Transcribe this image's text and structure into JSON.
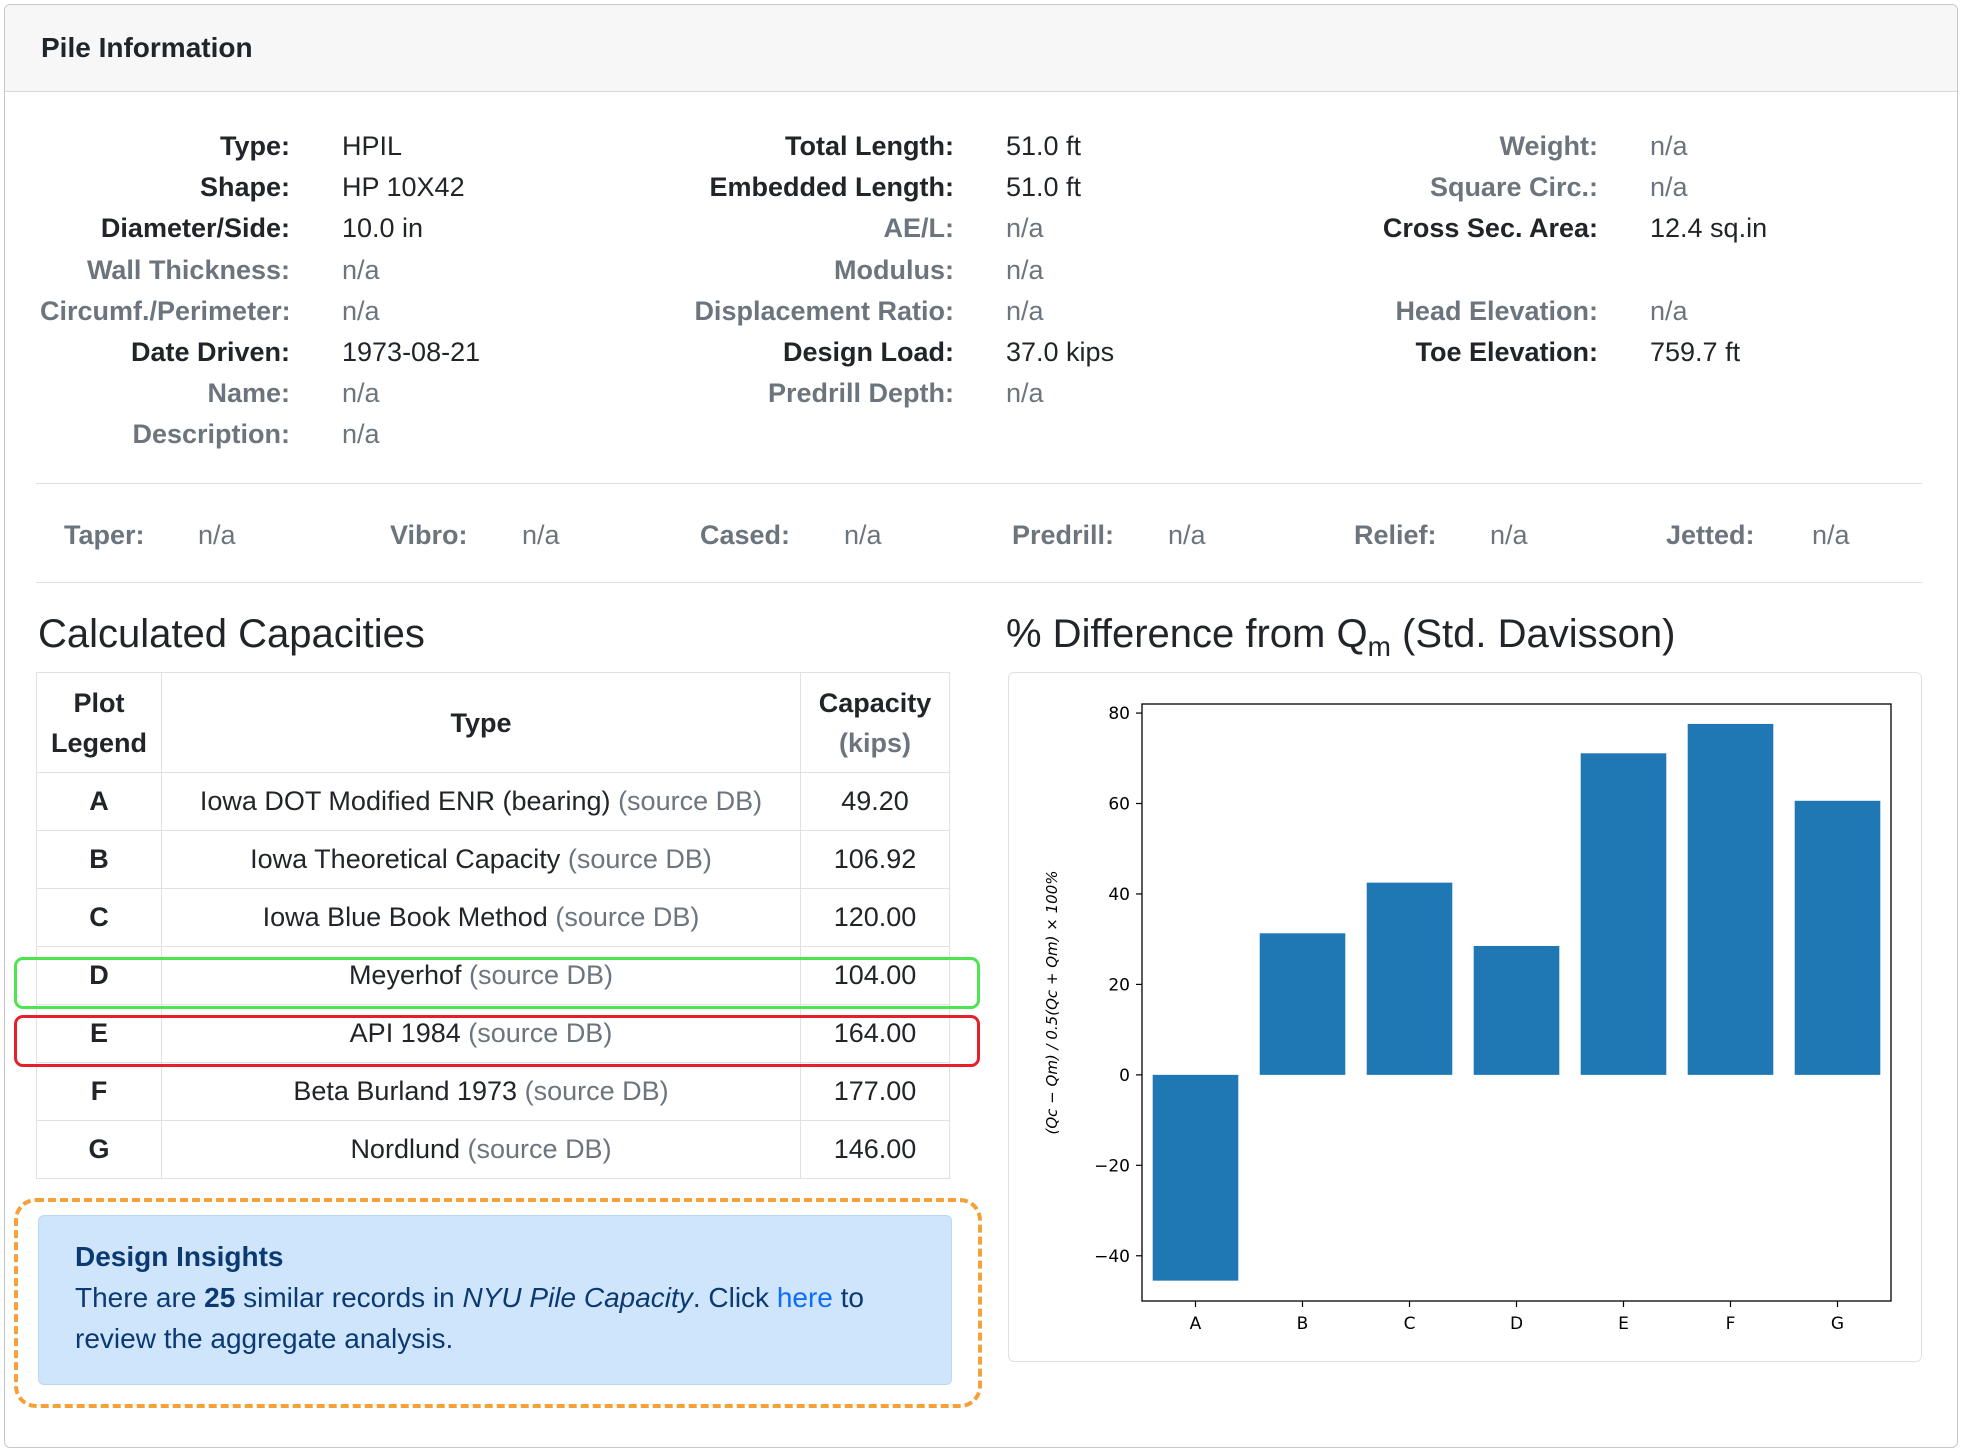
{
  "header": {
    "title": "Pile Information"
  },
  "info": {
    "col1": [
      {
        "label": "Type:",
        "value": "HPIL",
        "strong": true
      },
      {
        "label": "Shape:",
        "value": "HP 10X42",
        "strong": true
      },
      {
        "label": "Diameter/Side:",
        "value": "10.0 in",
        "strong": true
      },
      {
        "label": "Wall Thickness:",
        "value": "n/a",
        "strong": false
      },
      {
        "label": "Circumf./Perimeter:",
        "value": "n/a",
        "strong": false
      },
      {
        "label": "Date Driven:",
        "value": "1973-08-21",
        "strong": true
      },
      {
        "label": "Name:",
        "value": "n/a",
        "strong": false
      },
      {
        "label": "Description:",
        "value": "n/a",
        "strong": false
      }
    ],
    "col2": [
      {
        "label": "Total Length:",
        "value": "51.0 ft",
        "strong": true
      },
      {
        "label": "Embedded Length:",
        "value": "51.0 ft",
        "strong": true
      },
      {
        "label": "AE/L:",
        "value": "n/a",
        "strong": false
      },
      {
        "label": "Modulus:",
        "value": "n/a",
        "strong": false
      },
      {
        "label": "Displacement Ratio:",
        "value": "n/a",
        "strong": false
      },
      {
        "label": "Design Load:",
        "value": "37.0 kips",
        "strong": true
      },
      {
        "label": "Predrill Depth:",
        "value": "n/a",
        "strong": false
      }
    ],
    "col3": [
      {
        "label": "Weight:",
        "value": "n/a",
        "strong": false
      },
      {
        "label": "Square Circ.:",
        "value": "n/a",
        "strong": false
      },
      {
        "label": "Cross Sec. Area:",
        "value": "12.4 sq.in",
        "strong": true
      },
      {
        "label": "",
        "value": "",
        "strong": false
      },
      {
        "label": "Head Elevation:",
        "value": "n/a",
        "strong": false
      },
      {
        "label": "Toe Elevation:",
        "value": "759.7 ft",
        "strong": true
      }
    ]
  },
  "flags": [
    {
      "label": "Taper:",
      "value": "n/a"
    },
    {
      "label": "Vibro:",
      "value": "n/a"
    },
    {
      "label": "Cased:",
      "value": "n/a"
    },
    {
      "label": "Predrill:",
      "value": "n/a"
    },
    {
      "label": "Relief:",
      "value": "n/a"
    },
    {
      "label": "Jetted:",
      "value": "n/a"
    }
  ],
  "capacities": {
    "title": "Calculated Capacities",
    "headers": {
      "legend_line1": "Plot",
      "legend_line2": "Legend",
      "type": "Type",
      "cap_line1": "Capacity",
      "cap_line2": "(kips)"
    },
    "source_label": "(source DB)",
    "rows": [
      {
        "legend": "A",
        "type": "Iowa DOT Modified ENR (bearing)",
        "capacity": "49.20"
      },
      {
        "legend": "B",
        "type": "Iowa Theoretical Capacity",
        "capacity": "106.92"
      },
      {
        "legend": "C",
        "type": "Iowa Blue Book Method",
        "capacity": "120.00"
      },
      {
        "legend": "D",
        "type": "Meyerhof",
        "capacity": "104.00"
      },
      {
        "legend": "E",
        "type": "API 1984",
        "capacity": "164.00"
      },
      {
        "legend": "F",
        "type": "Beta Burland 1973",
        "capacity": "177.00"
      },
      {
        "legend": "G",
        "type": "Nordlund",
        "capacity": "146.00"
      }
    ]
  },
  "insights": {
    "title": "Design Insights",
    "text_prefix": "There are ",
    "count": "25",
    "text_mid": " similar records in ",
    "dataset": "NYU Pile Capacity",
    "text_click": ". Click ",
    "link_text": "here",
    "text_suffix": " to review the aggregate analysis."
  },
  "chart_title": {
    "main": "% Difference from Q",
    "subscript": "m",
    "suffix": " (Std. Davisson)"
  },
  "chart_data": {
    "type": "bar",
    "categories": [
      "A",
      "B",
      "C",
      "D",
      "E",
      "F",
      "G"
    ],
    "values": [
      -45.5,
      31.3,
      42.5,
      28.5,
      71.1,
      77.6,
      60.6
    ],
    "ylim": [
      -50,
      82
    ],
    "yticks": [
      -40,
      -20,
      0,
      20,
      40,
      60,
      80
    ],
    "ytick_labels": [
      "−40",
      "−20",
      "0",
      "20",
      "40",
      "60",
      "80"
    ],
    "ylabel": "(Qc − Qm) / 0.5(Qc + Qm) × 100%",
    "bar_color": "#1f77b4"
  },
  "colors": {
    "highlight_green": "#4ee44e",
    "highlight_red": "#e5202a",
    "insights_border": "#f4a13a"
  }
}
